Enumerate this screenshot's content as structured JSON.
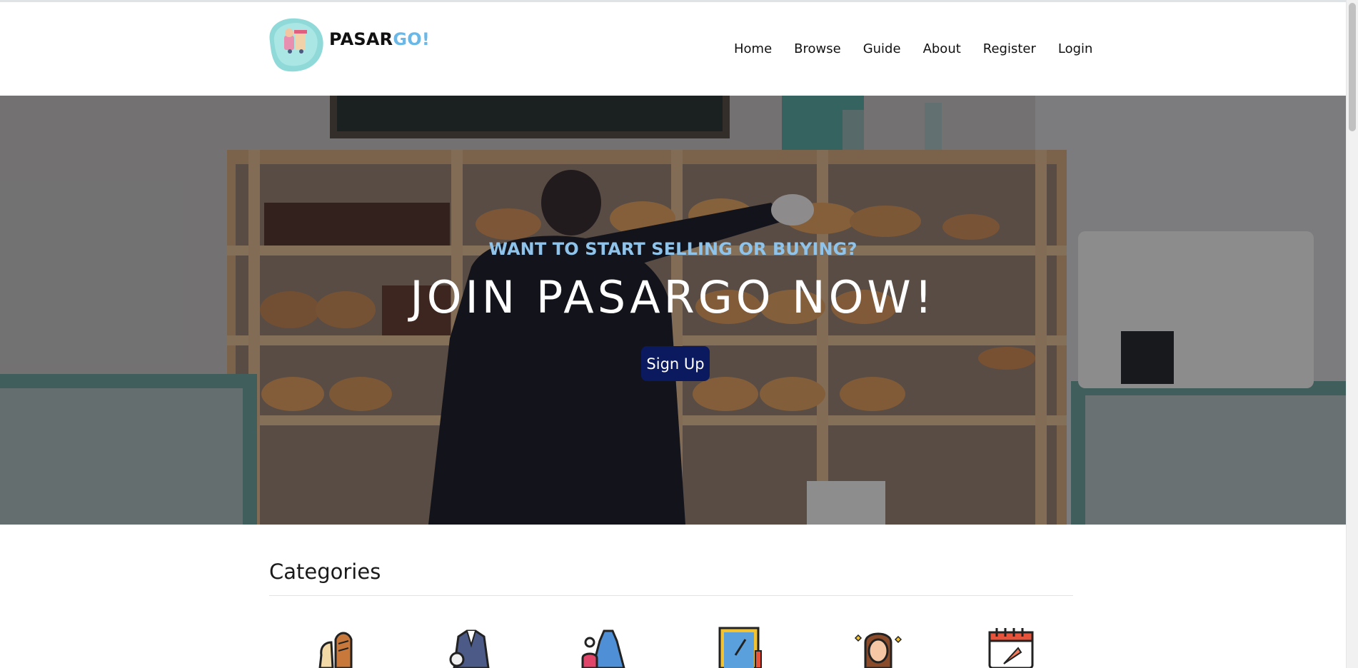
{
  "brand": {
    "name_part1": "PASAR",
    "name_part2": "GO!",
    "color_dark": "#111111",
    "color_accent": "#6bb7e6",
    "logo_icon": "shop-mascot-logo-icon"
  },
  "nav": {
    "items": [
      {
        "label": "Home"
      },
      {
        "label": "Browse"
      },
      {
        "label": "Guide"
      },
      {
        "label": "About"
      },
      {
        "label": "Register"
      },
      {
        "label": "Login"
      }
    ]
  },
  "hero": {
    "kicker": "WANT TO START SELLING OR BUYING?",
    "title": "JOIN PASARGO NOW!",
    "cta_label": "Sign Up",
    "cta_color": "#0b1a5e",
    "kicker_color": "#8fc3ea",
    "background": "bakery-photo"
  },
  "categories": {
    "heading": "Categories",
    "icons": [
      "bread-food-icon",
      "suit-clothing-icon",
      "dress-fashion-icon",
      "art-craft-icon",
      "beauty-woman-icon",
      "calendar-event-icon"
    ]
  }
}
